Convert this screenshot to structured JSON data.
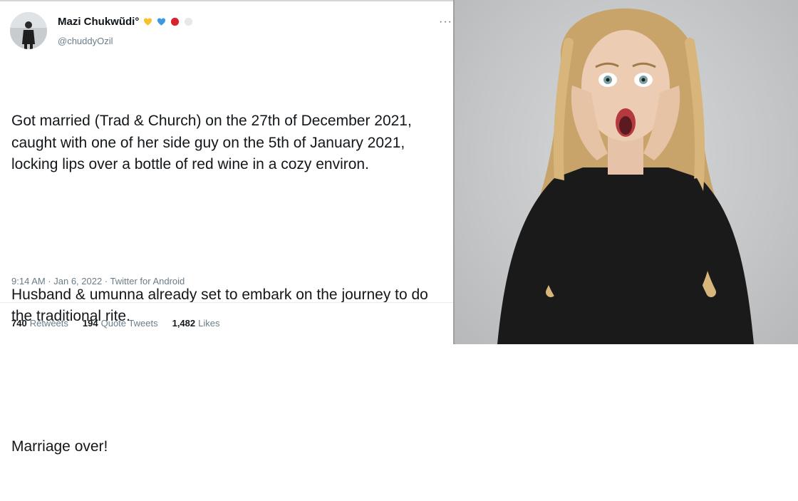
{
  "tweet": {
    "display_name": "Mazi Chukwũdi°",
    "handle": "@chuddyOzil",
    "more_label": "···",
    "paragraphs": [
      "Got married (Trad & Church) on the 27th of December 2021, caught with one of her side guy on the 5th of January 2021, locking lips over a bottle of red wine in a cozy environ.",
      "Husband & umunna already set to embark on the journey to do the traditional rite.",
      "Marriage over!"
    ],
    "meta": "9:14 AM · Jan 6, 2022 · Twitter for Android",
    "stats": {
      "retweets_count": "740",
      "retweets_label": "Retweets",
      "quotes_count": "194",
      "quotes_label": "Quote Tweets",
      "likes_count": "1,482",
      "likes_label": "Likes"
    },
    "name_emojis": [
      "yellow-heart",
      "blue-heart",
      "red-circle",
      "white-circle"
    ]
  },
  "colors": {
    "text": "#0f1419",
    "secondary_text": "#6b7c88",
    "yellow_heart": "#f7c22e",
    "blue_heart": "#3c9be0",
    "red_circle": "#d9232f",
    "white_circle": "#e8e8e8",
    "photo_background": "#c9cbcd",
    "hair": "#c9a46a",
    "top": "#1a1a1a"
  },
  "photo": {
    "icon": "shocked-woman-photo"
  }
}
